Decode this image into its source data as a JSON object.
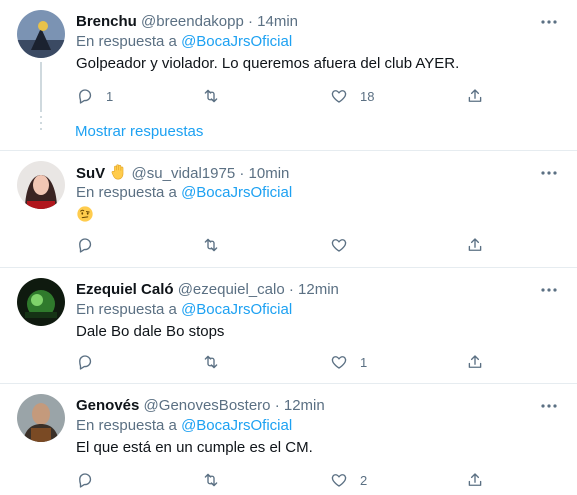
{
  "tweets": [
    {
      "name": "Brenchu",
      "handle": "@breendakopp",
      "dot": "·",
      "time": "14min",
      "replying_prefix": "En respuesta a",
      "mention": "@BocaJrsOficial",
      "text": "Golpeador y violador. Lo queremos afuera del club AYER.",
      "replies": "1",
      "retweets": "",
      "likes": "18"
    },
    {
      "name": "SuV",
      "handle": "@su_vidal1975",
      "dot": "·",
      "time": "10min",
      "replying_prefix": "En respuesta a",
      "mention": "@BocaJrsOficial",
      "text": "",
      "replies": "",
      "retweets": "",
      "likes": ""
    },
    {
      "name": "Ezequiel Caló",
      "handle": "@ezequiel_calo",
      "dot": "·",
      "time": "12min",
      "replying_prefix": "En respuesta a",
      "mention": "@BocaJrsOficial",
      "text": "Dale Bo dale Bo stops",
      "replies": "",
      "retweets": "",
      "likes": "1"
    },
    {
      "name": "Genovés",
      "handle": "@GenovesBostero",
      "dot": "·",
      "time": "12min",
      "replying_prefix": "En respuesta a",
      "mention": "@BocaJrsOficial",
      "text": "El que está en un cumple es el CM.",
      "replies": "",
      "retweets": "",
      "likes": "2"
    }
  ],
  "show_replies_label": "Mostrar respuestas",
  "icons": {
    "more": "more-icon",
    "reply": "reply-icon",
    "retweet": "retweet-icon",
    "like": "heart-icon",
    "share": "share-icon",
    "hand_emoji": "raised-hand-emoji",
    "face_emoji": "face-with-raised-eyebrow-emoji"
  },
  "colors": {
    "accent": "#1da1f2",
    "secondary_text": "#5b7083",
    "divider": "#e6ecf0"
  }
}
